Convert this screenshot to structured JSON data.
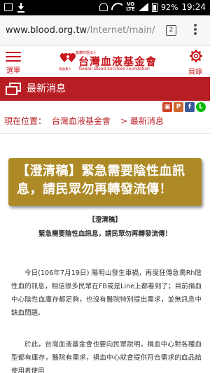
{
  "status_bar": {
    "volte_top": "VO",
    "volte_bottom": "LTE",
    "battery": "92%",
    "time": "19:24"
  },
  "browser": {
    "url_host": "www.blood.org.tw",
    "url_path": "/Internet/main/",
    "tab_count": "2"
  },
  "header": {
    "menu_label": "選單",
    "directory_label": "目錄",
    "logo_small": "醫療財團法人",
    "logo_name": "台灣血液基金會",
    "logo_en": "Taiwan Blood Services Foundation",
    "logo_sub": "捐血救人"
  },
  "banner": {
    "title": "最新消息",
    "color": "#b71e23"
  },
  "share": [
    {
      "icon": "print-icon",
      "glyph": "▣",
      "color": "#d0452a"
    },
    {
      "icon": "plurk-icon",
      "glyph": "P",
      "color": "#cf682f"
    },
    {
      "icon": "facebook-icon",
      "glyph": "f",
      "color": "#3b5998"
    },
    {
      "icon": "line-icon",
      "glyph": "L",
      "color": "#00b900"
    }
  ],
  "breadcrumb": {
    "label": "現在位置：",
    "home": "台灣血液基金會",
    "separator": ">",
    "current": "最新消息"
  },
  "headline": {
    "line1": "【澄清稿】緊急需要陰性血訊",
    "line2": "息，請民眾勿再轉發流傳！",
    "color": "#ad8a26"
  },
  "article": {
    "tag": "【澄清稿】",
    "subtitle": "緊急需要陰性血訊息，請民眾勿再轉發流傳！",
    "paragraph1": "今日(106年7月19日) 陽明山發生車禍，再度狂傳急需Rh陰性血的訊息，相信很多民眾在FB或是Line上都看到了；目前捐血中心陰性血庫存都足夠，也沒有醫院特別提出需求，並無訊息中缺血問題。",
    "paragraph2": "於此，台灣血液基金會也要向民眾說明，捐血中心對各種血型都有庫存，醫院有需求，捐血中心就會提供符合需求的血品給使用者使用"
  }
}
